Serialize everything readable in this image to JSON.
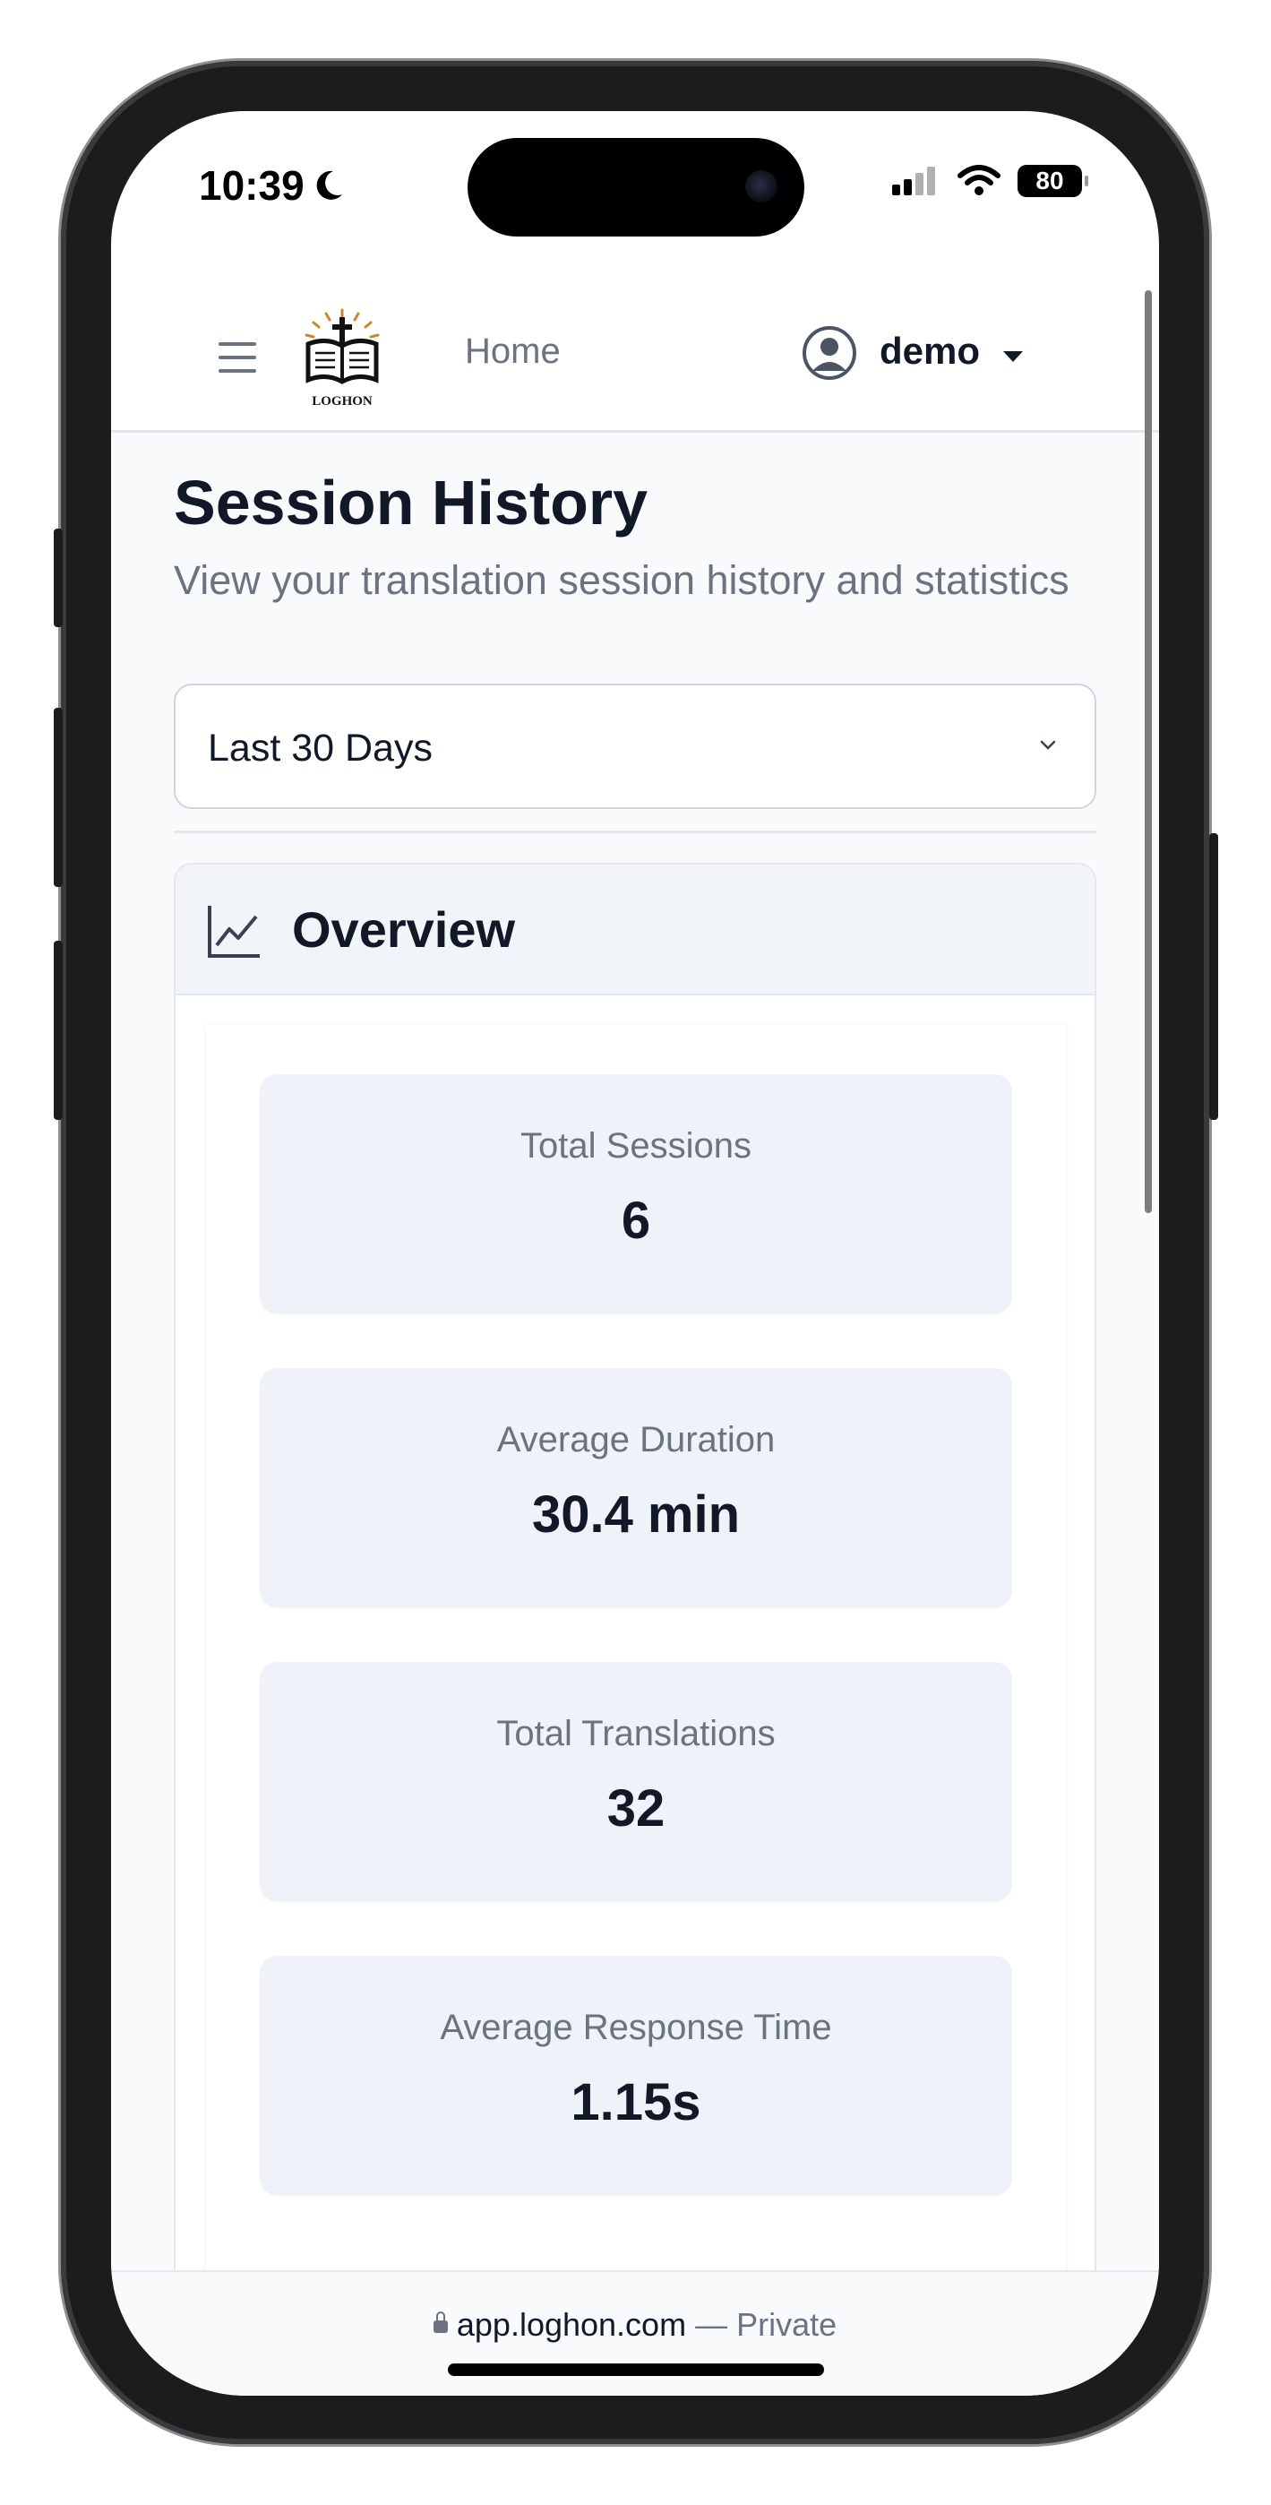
{
  "status_bar": {
    "time": "10:39",
    "battery": "80"
  },
  "navbar": {
    "logo_text": "LOGHON",
    "home_link": "Home",
    "username": "demo"
  },
  "page": {
    "title": "Session History",
    "subtitle": "View your translation session history and statistics"
  },
  "filter": {
    "selected": "Last 30 Days"
  },
  "overview": {
    "title": "Overview",
    "stats": [
      {
        "label": "Total Sessions",
        "value": "6"
      },
      {
        "label": "Average Duration",
        "value": "30.4 min"
      },
      {
        "label": "Total Translations",
        "value": "32"
      },
      {
        "label": "Average Response Time",
        "value": "1.15s"
      }
    ]
  },
  "browser": {
    "url": "app.loghon.com",
    "mode": "— Private"
  },
  "colors": {
    "text_primary": "#111827",
    "text_muted": "#6b7280",
    "stat_background": "#eff2f8",
    "page_background": "#f8fafc"
  }
}
